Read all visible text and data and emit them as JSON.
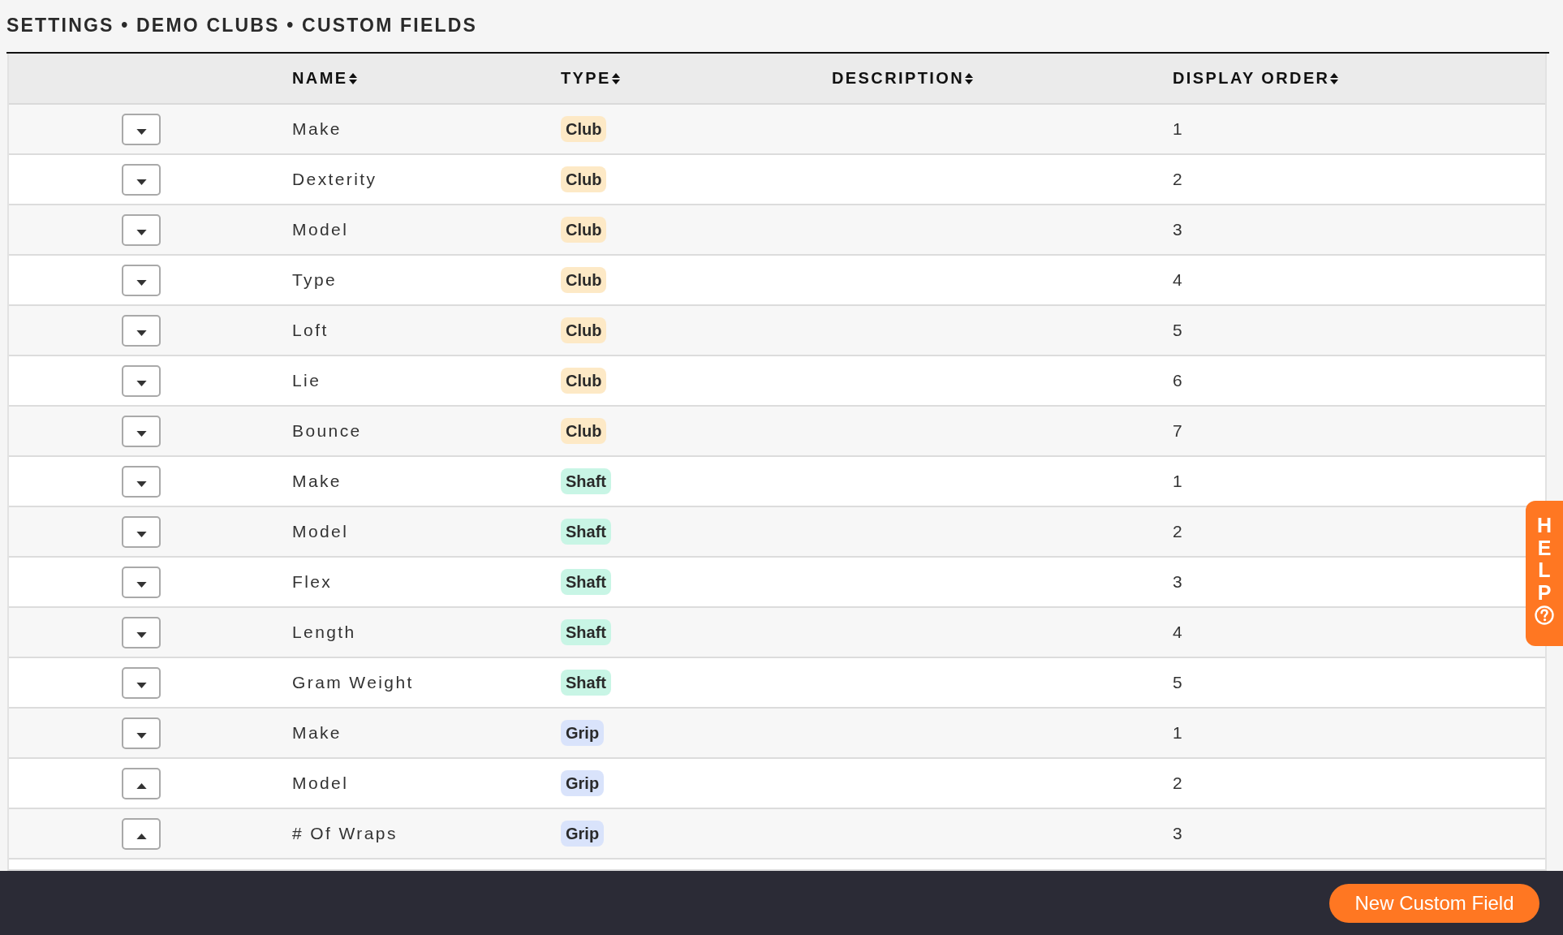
{
  "breadcrumb": "SETTINGS • DEMO CLUBS • CUSTOM FIELDS",
  "table": {
    "columns": [
      {
        "label": "NAME",
        "sortable": true
      },
      {
        "label": "TYPE",
        "sortable": true
      },
      {
        "label": "DESCRIPTION",
        "sortable": true
      },
      {
        "label": "DISPLAY ORDER",
        "sortable": true
      }
    ],
    "rows": [
      {
        "name": "Make",
        "type": "Club",
        "color": "#fde9c6",
        "display_order": "1",
        "dropup": false
      },
      {
        "name": "Dexterity",
        "type": "Club",
        "color": "#fde9c6",
        "display_order": "2",
        "dropup": false
      },
      {
        "name": "Model",
        "type": "Club",
        "color": "#fde9c6",
        "display_order": "3",
        "dropup": false
      },
      {
        "name": "Type",
        "type": "Club",
        "color": "#fde9c6",
        "display_order": "4",
        "dropup": false
      },
      {
        "name": "Loft",
        "type": "Club",
        "color": "#fde9c6",
        "display_order": "5",
        "dropup": false
      },
      {
        "name": "Lie",
        "type": "Club",
        "color": "#fde9c6",
        "display_order": "6",
        "dropup": false
      },
      {
        "name": "Bounce",
        "type": "Club",
        "color": "#fde9c6",
        "display_order": "7",
        "dropup": false
      },
      {
        "name": "Make",
        "type": "Shaft",
        "color": "#c8f5e5",
        "display_order": "1",
        "dropup": false
      },
      {
        "name": "Model",
        "type": "Shaft",
        "color": "#c8f5e5",
        "display_order": "2",
        "dropup": false
      },
      {
        "name": "Flex",
        "type": "Shaft",
        "color": "#c8f5e5",
        "display_order": "3",
        "dropup": false
      },
      {
        "name": "Length",
        "type": "Shaft",
        "color": "#c8f5e5",
        "display_order": "4",
        "dropup": false
      },
      {
        "name": "Gram Weight",
        "type": "Shaft",
        "color": "#c8f5e5",
        "display_order": "5",
        "dropup": false
      },
      {
        "name": "Make",
        "type": "Grip",
        "color": "#d9e3fb",
        "display_order": "1",
        "dropup": false
      },
      {
        "name": "Model",
        "type": "Grip",
        "color": "#d9e3fb",
        "display_order": "2",
        "dropup": true
      },
      {
        "name": "# Of Wraps",
        "type": "Grip",
        "color": "#d9e3fb",
        "display_order": "3",
        "dropup": true
      }
    ]
  },
  "help_tab": {
    "label": "HELP"
  },
  "footer": {
    "button": "New Custom Field"
  }
}
